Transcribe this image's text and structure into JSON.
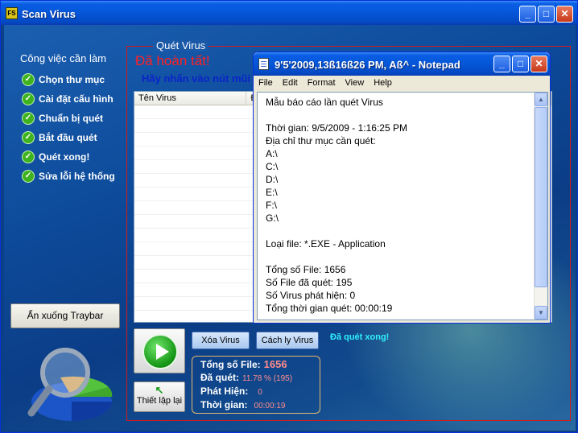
{
  "main_window": {
    "title": "Scan Virus",
    "controls": {
      "minimize": "_",
      "maximize": "□",
      "close": "✕"
    }
  },
  "tasks": {
    "header": "Công việc cần làm",
    "items": [
      "Chọn thư mục",
      "Cài đặt cấu hình",
      "Chuẩn bị quét",
      "Bắt đầu quét",
      "Quét xong!",
      "Sửa lỗi hệ thống"
    ]
  },
  "tray_button": "Ẩn xuống Traybar",
  "scan": {
    "legend": "Quét Virus",
    "status": "Đã hoàn tất!",
    "hint": "Hãy nhấn vào nút mũi",
    "table_headers": [
      "Tên Virus",
      "Đư"
    ],
    "delete_button": "Xóa Virus",
    "quarantine_button": "Cách ly Virus",
    "complete_text": "Đã quét xong!",
    "reset_button": "Thiết lập lại",
    "stats": {
      "total_label": "Tổng số File:",
      "total_value": "1656",
      "scanned_label": "Đã quét:",
      "scanned_value": "11.78 % (195)",
      "found_label": "Phát Hiện:",
      "found_value": "0",
      "time_label": "Thời gian:",
      "time_value": "00:00:19"
    }
  },
  "notepad": {
    "title": "9'5'2009,13ß16ß26 PM, Aß^ - Notepad",
    "menu": [
      "File",
      "Edit",
      "Format",
      "View",
      "Help"
    ],
    "lines": [
      "Mẫu báo cáo lần quét Virus",
      "",
      "Thời gian: 9/5/2009 - 1:16:25 PM",
      "Địa chỉ thư mục cần quét:",
      "A:\\",
      "C:\\",
      "D:\\",
      "E:\\",
      "F:\\",
      "G:\\",
      "",
      "Loại file: *.EXE - Application",
      "",
      "Tổng số File: 1656",
      "Số File đã quét: 195",
      "Số Virus phát hiện: 0",
      "Tổng thời gian quét: 00:00:19"
    ]
  },
  "colors": {
    "window_bg": "#0b3f86",
    "status_red": "#ff2121",
    "hint_blue": "#0b24c8",
    "complete_cyan": "#2ef1ff",
    "stat_value": "#ff8c8c"
  }
}
